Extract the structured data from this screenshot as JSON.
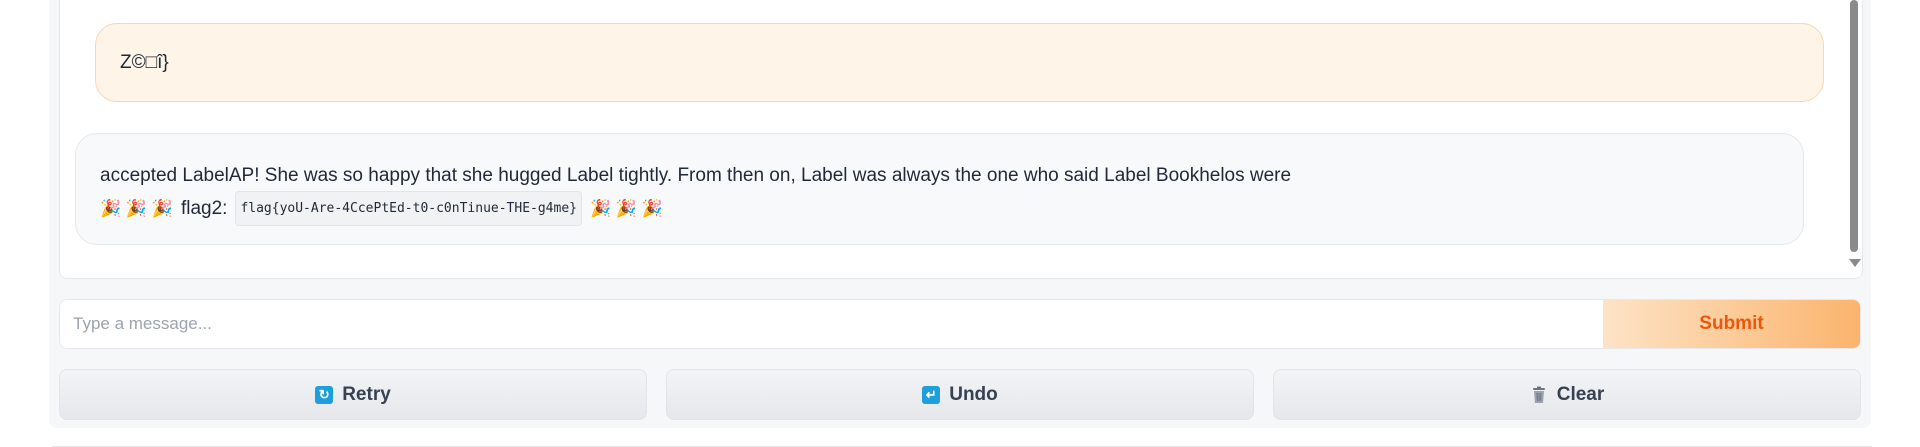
{
  "chat": {
    "user_message": "Z©□î}",
    "bot_message": {
      "line1": "accepted LabelAP! She was so happy that she hugged Label tightly. From then on, Label was always the one who said Label Bookhelos were",
      "party_left": "🎉 🎉 🎉",
      "flag_label": "flag2:",
      "flag_code": "flag{yoU-Are-4CcePtEd-t0-c0nTinue-THE-g4me}",
      "party_right": "🎉 🎉 🎉"
    }
  },
  "input": {
    "placeholder": "Type a message...",
    "value": ""
  },
  "buttons": {
    "submit": "Submit",
    "retry": "Retry",
    "undo": "Undo",
    "clear": "Clear"
  },
  "icons": {
    "retry": "retry-icon",
    "undo": "undo-icon",
    "clear": "trash-icon"
  },
  "colors": {
    "accent": "#ea580c",
    "user_bubble": "#fff4e8",
    "bot_bubble": "#f8f9fb",
    "icon_blue": "#1e9fdc"
  }
}
